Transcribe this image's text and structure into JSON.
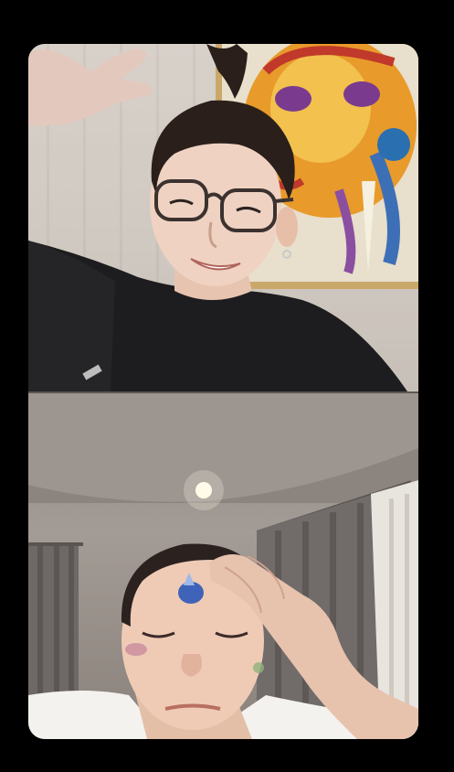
{
  "call": {
    "participants": [
      {
        "role": "top"
      },
      {
        "role": "bottom"
      }
    ]
  },
  "colors": {
    "background": "#000000",
    "frame_border": "#111111"
  }
}
